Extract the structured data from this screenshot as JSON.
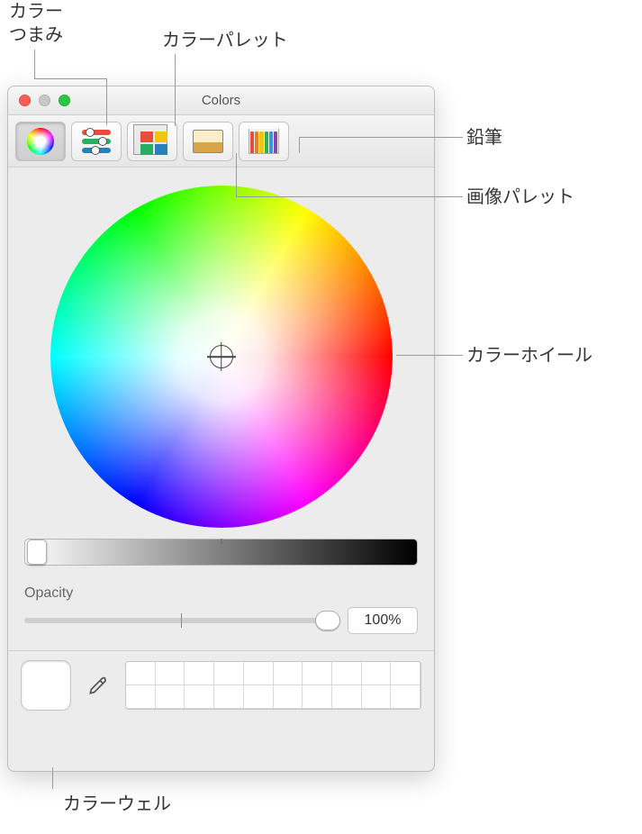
{
  "callouts": {
    "color_knob": "カラー\nつまみ",
    "color_palette": "カラーパレット",
    "pencils": "鉛筆",
    "image_palette": "画像パレット",
    "color_wheel": "カラーホイール",
    "color_well": "カラーウェル"
  },
  "window": {
    "title": "Colors",
    "opacity_label": "Opacity",
    "opacity_value": "100%"
  }
}
